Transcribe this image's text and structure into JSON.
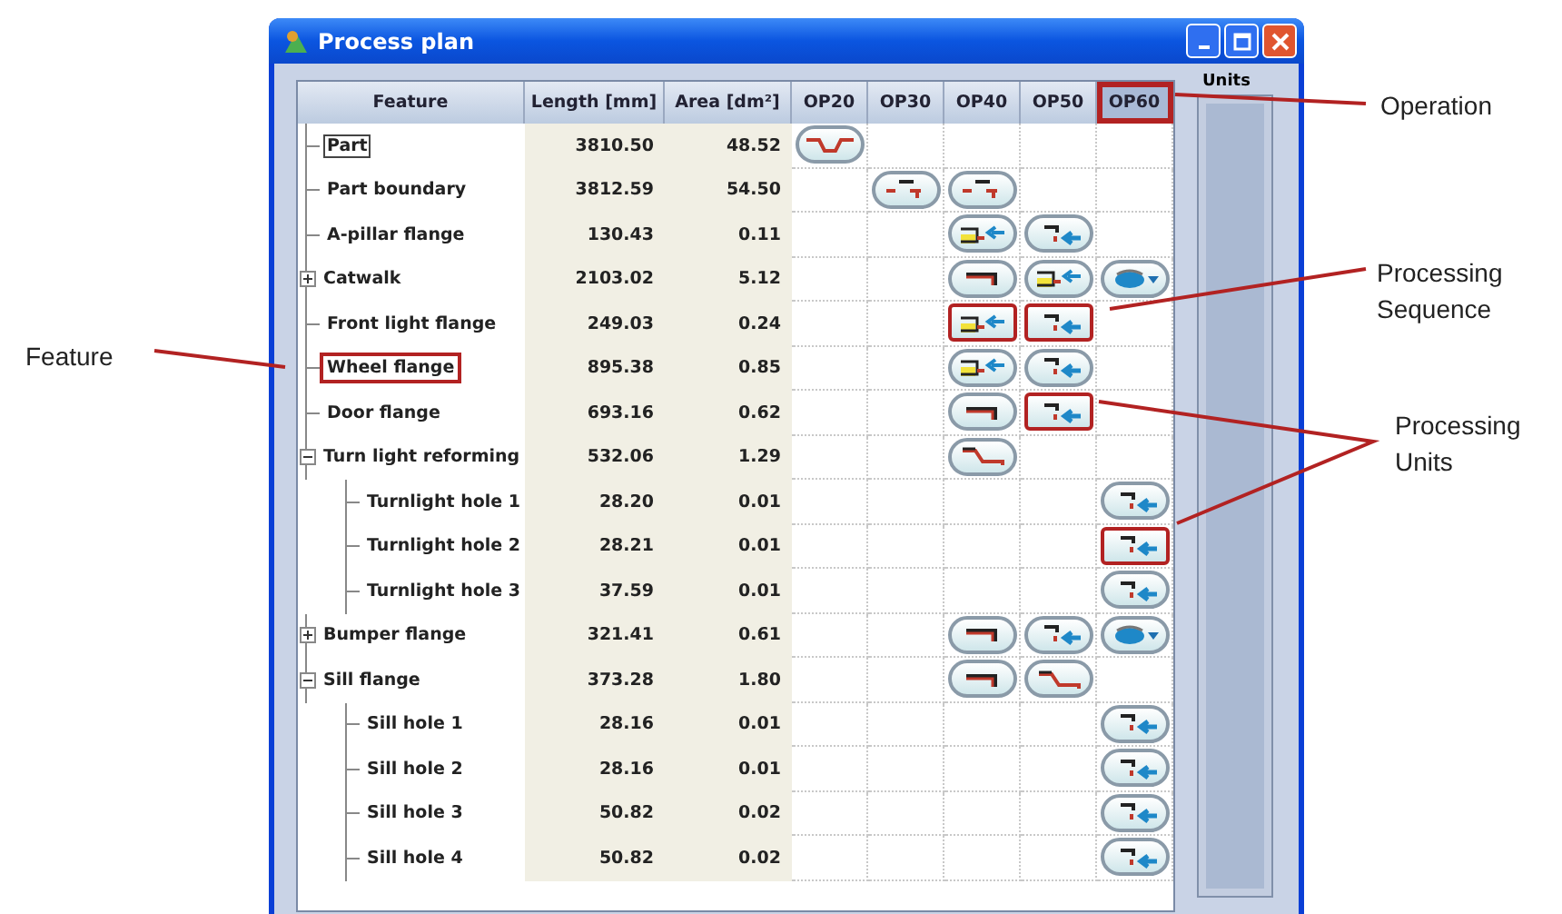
{
  "window": {
    "title": "Process plan"
  },
  "columns": [
    {
      "label": "Feature",
      "highlighted": false
    },
    {
      "label": "Length [mm]",
      "highlighted": false
    },
    {
      "label": "Area [dm²]",
      "highlighted": false
    },
    {
      "label": "OP20",
      "highlighted": false
    },
    {
      "label": "OP30",
      "highlighted": false
    },
    {
      "label": "OP40",
      "highlighted": false
    },
    {
      "label": "OP50",
      "highlighted": false
    },
    {
      "label": "OP60",
      "highlighted": true
    }
  ],
  "units_panel": {
    "label": "Units"
  },
  "features": [
    {
      "name": "Part",
      "length": "3810.50",
      "area": "48.52",
      "selected": true,
      "units": [
        {
          "kind": "dip"
        },
        {
          "kind": "empty"
        },
        {
          "kind": "empty"
        },
        {
          "kind": "empty"
        },
        {
          "kind": "empty"
        }
      ]
    },
    {
      "name": "Part boundary",
      "length": "3812.59",
      "area": "54.50",
      "selected": false,
      "units": [
        {
          "kind": "empty"
        },
        {
          "kind": "trim"
        },
        {
          "kind": "trim"
        },
        {
          "kind": "empty"
        },
        {
          "kind": "empty"
        }
      ]
    },
    {
      "name": "A-pillar flange",
      "length": "130.43",
      "area": "0.11",
      "selected": false,
      "units": [
        {
          "kind": "empty"
        },
        {
          "kind": "empty"
        },
        {
          "kind": "hem"
        },
        {
          "kind": "bend"
        },
        {
          "kind": "empty"
        }
      ]
    },
    {
      "name": "Catwalk",
      "length": "2103.02",
      "area": "5.12",
      "selected": false,
      "expanded": false,
      "units": [
        {
          "kind": "empty"
        },
        {
          "kind": "empty"
        },
        {
          "kind": "corner"
        },
        {
          "kind": "hem"
        },
        {
          "kind": "flange"
        }
      ]
    },
    {
      "name": "Front light flange",
      "length": "249.03",
      "area": "0.24",
      "selected": false,
      "units": [
        {
          "kind": "empty"
        },
        {
          "kind": "empty"
        },
        {
          "kind": "hem",
          "highlighted": true
        },
        {
          "kind": "bend",
          "highlighted": true
        },
        {
          "kind": "empty"
        }
      ]
    },
    {
      "name": "Wheel flange",
      "length": "895.38",
      "area": "0.85",
      "selected": false,
      "highlighted": true,
      "units": [
        {
          "kind": "empty"
        },
        {
          "kind": "empty"
        },
        {
          "kind": "hem"
        },
        {
          "kind": "bend"
        },
        {
          "kind": "empty"
        }
      ]
    },
    {
      "name": "Door flange",
      "length": "693.16",
      "area": "0.62",
      "selected": false,
      "units": [
        {
          "kind": "empty"
        },
        {
          "kind": "empty"
        },
        {
          "kind": "corner"
        },
        {
          "kind": "bend",
          "highlighted": true
        },
        {
          "kind": "empty"
        }
      ]
    },
    {
      "name": "Turn light reforming",
      "length": "532.06",
      "area": "1.29",
      "selected": false,
      "expanded": true,
      "units": [
        {
          "kind": "empty"
        },
        {
          "kind": "empty"
        },
        {
          "kind": "step"
        },
        {
          "kind": "empty"
        },
        {
          "kind": "empty"
        }
      ],
      "children": [
        {
          "name": "Turnlight hole 1",
          "length": "28.20",
          "area": "0.01",
          "selected": false,
          "units": [
            {
              "kind": "empty"
            },
            {
              "kind": "empty"
            },
            {
              "kind": "empty"
            },
            {
              "kind": "empty"
            },
            {
              "kind": "bend"
            }
          ]
        },
        {
          "name": "Turnlight hole 2",
          "length": "28.21",
          "area": "0.01",
          "selected": false,
          "units": [
            {
              "kind": "empty"
            },
            {
              "kind": "empty"
            },
            {
              "kind": "empty"
            },
            {
              "kind": "empty"
            },
            {
              "kind": "bend",
              "highlighted": true
            }
          ]
        },
        {
          "name": "Turnlight hole 3",
          "length": "37.59",
          "area": "0.01",
          "selected": false,
          "units": [
            {
              "kind": "empty"
            },
            {
              "kind": "empty"
            },
            {
              "kind": "empty"
            },
            {
              "kind": "empty"
            },
            {
              "kind": "bend"
            }
          ]
        }
      ]
    },
    {
      "name": "Bumper flange",
      "length": "321.41",
      "area": "0.61",
      "selected": false,
      "expanded": false,
      "units": [
        {
          "kind": "empty"
        },
        {
          "kind": "empty"
        },
        {
          "kind": "corner"
        },
        {
          "kind": "bend"
        },
        {
          "kind": "flange"
        }
      ]
    },
    {
      "name": "Sill flange",
      "length": "373.28",
      "area": "1.80",
      "selected": false,
      "expanded": true,
      "units": [
        {
          "kind": "empty"
        },
        {
          "kind": "empty"
        },
        {
          "kind": "corner"
        },
        {
          "kind": "step"
        },
        {
          "kind": "empty"
        }
      ],
      "children": [
        {
          "name": "Sill hole 1",
          "length": "28.16",
          "area": "0.01",
          "selected": false,
          "units": [
            {
              "kind": "empty"
            },
            {
              "kind": "empty"
            },
            {
              "kind": "empty"
            },
            {
              "kind": "empty"
            },
            {
              "kind": "bend"
            }
          ]
        },
        {
          "name": "Sill hole 2",
          "length": "28.16",
          "area": "0.01",
          "selected": false,
          "units": [
            {
              "kind": "empty"
            },
            {
              "kind": "empty"
            },
            {
              "kind": "empty"
            },
            {
              "kind": "empty"
            },
            {
              "kind": "bend"
            }
          ]
        },
        {
          "name": "Sill hole 3",
          "length": "50.82",
          "area": "0.02",
          "selected": false,
          "units": [
            {
              "kind": "empty"
            },
            {
              "kind": "empty"
            },
            {
              "kind": "empty"
            },
            {
              "kind": "empty"
            },
            {
              "kind": "bend"
            }
          ]
        },
        {
          "name": "Sill hole 4",
          "length": "50.82",
          "area": "0.02",
          "selected": false,
          "units": [
            {
              "kind": "empty"
            },
            {
              "kind": "empty"
            },
            {
              "kind": "empty"
            },
            {
              "kind": "empty"
            },
            {
              "kind": "bend"
            }
          ]
        }
      ]
    }
  ],
  "callouts": [
    {
      "label": "Operation"
    },
    {
      "label": "Processing Sequence"
    },
    {
      "label": "Processing Units"
    },
    {
      "label": "Feature"
    }
  ]
}
